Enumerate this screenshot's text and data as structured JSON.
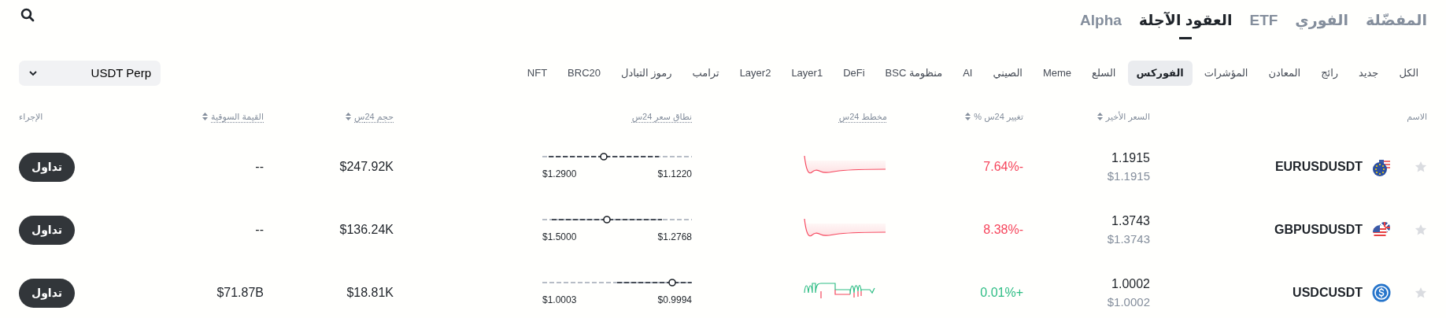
{
  "main_tabs": [
    {
      "label": "المفضّلة",
      "selected": false
    },
    {
      "label": "الفوري",
      "selected": false
    },
    {
      "label": "ETF",
      "selected": false
    },
    {
      "label": "العقود الآجلة",
      "selected": true
    },
    {
      "label": "Alpha",
      "selected": false
    }
  ],
  "filters": [
    {
      "label": "الكل",
      "selected": false
    },
    {
      "label": "جديد",
      "selected": false
    },
    {
      "label": "رائج",
      "selected": false
    },
    {
      "label": "المعادن",
      "selected": false
    },
    {
      "label": "المؤشرات",
      "selected": false
    },
    {
      "label": "الفوركس",
      "selected": true
    },
    {
      "label": "السلع",
      "selected": false
    },
    {
      "label": "Meme",
      "selected": false
    },
    {
      "label": "الصيني",
      "selected": false
    },
    {
      "label": "AI",
      "selected": false
    },
    {
      "label": "منظومة BSC",
      "selected": false
    },
    {
      "label": "DeFi",
      "selected": false
    },
    {
      "label": "Layer1",
      "selected": false
    },
    {
      "label": "Layer2",
      "selected": false
    },
    {
      "label": "ترامب",
      "selected": false
    },
    {
      "label": "رموز التبادل",
      "selected": false
    },
    {
      "label": "BRC20",
      "selected": false
    },
    {
      "label": "NFT",
      "selected": false
    }
  ],
  "contract_select": {
    "value": "USDT Perp"
  },
  "table": {
    "columns": [
      {
        "label": "الاسم",
        "sortable": false,
        "hint": false
      },
      {
        "label": "السعر الأخير",
        "sortable": true,
        "hint": false
      },
      {
        "label": "تغيير 24س %",
        "sortable": true,
        "hint": false
      },
      {
        "label": "مخطط 24س",
        "sortable": false,
        "hint": true
      },
      {
        "label": "نطاق سعر 24س",
        "sortable": false,
        "hint": true
      },
      {
        "label": "حجم 24س",
        "sortable": true,
        "hint": true
      },
      {
        "label": "القيمة السوقية",
        "sortable": true,
        "hint": true
      },
      {
        "label": "الإجراء",
        "sortable": false,
        "hint": false
      }
    ],
    "rows": [
      {
        "favorite": false,
        "symbol": "EURUSDUSDT",
        "last_price": "1.1915",
        "last_price_usd": "$1.1915",
        "change": "7.64%-",
        "kind": "down",
        "range_high": "$1.2900",
        "range_low": "$1.1220",
        "level": 0.41,
        "volume": "$247.92K",
        "market_cap": "--",
        "action": "تداول"
      },
      {
        "favorite": false,
        "symbol": "GBPUSDUSDT",
        "last_price": "1.3743",
        "last_price_usd": "$1.3743",
        "change": "8.38%-",
        "kind": "down",
        "range_high": "$1.5000",
        "range_low": "$1.2768",
        "level": 0.43,
        "volume": "$136.24K",
        "market_cap": "--",
        "action": "تداول"
      },
      {
        "favorite": false,
        "symbol": "USDCUSDT",
        "last_price": "1.0002",
        "last_price_usd": "$1.0002",
        "change": "0.01%+",
        "kind": "up",
        "range_high": "$1.0003",
        "range_low": "$0.9994",
        "level": 0.87,
        "volume": "$18.81K",
        "market_cap": "$71.87B",
        "action": "تداول"
      }
    ]
  }
}
